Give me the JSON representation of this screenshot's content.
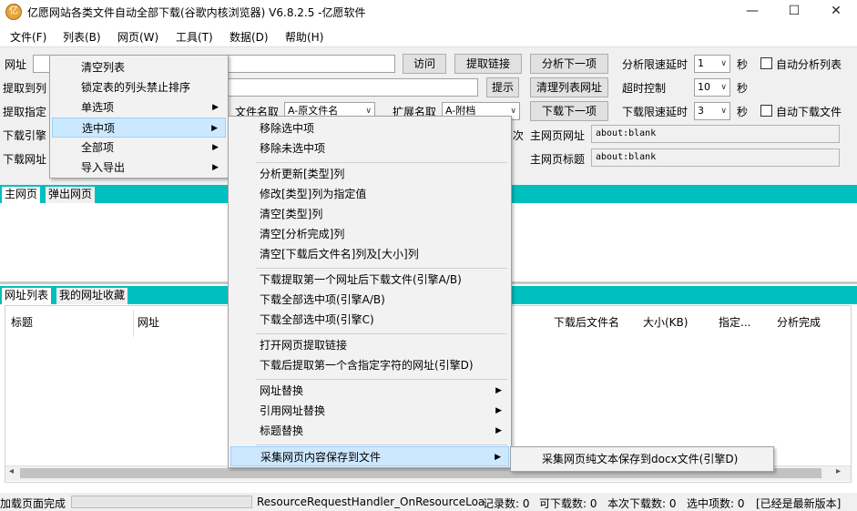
{
  "window": {
    "title": "亿愿网站各类文件自动全部下载(谷歌内核浏览器) V6.8.2.5 -亿愿软件",
    "minimize": "—",
    "maximize": "☐",
    "close": "✕"
  },
  "menubar": [
    "文件(F)",
    "列表(B)",
    "网页(W)",
    "工具(T)",
    "数据(D)",
    "帮助(H)"
  ],
  "form": {
    "url_label": "网址",
    "visit_btn": "访问",
    "extract_btn": "提取链接",
    "analyze_next_btn": "分析下一项",
    "analyze_delay_label": "分析限速延时",
    "analyze_delay_value": "1",
    "sec1": "秒",
    "auto_analyze": "自动分析列表",
    "row2_label": "提取到列",
    "hint_btn": "提示",
    "clear_list_url_btn": "清理列表网址",
    "timeout_label": "超时控制",
    "timeout_value": "10",
    "sec2": "秒",
    "row3_label": "提取指定",
    "filename_label": "文件名取",
    "filename_value": "A-原文件名",
    "ext_label": "扩展名取",
    "ext_value": "A-附档",
    "download_next_btn": "下载下一项",
    "download_delay_label": "下载限速延时",
    "download_delay_value": "3",
    "sec3": "秒",
    "auto_download": "自动下载文件",
    "row4_label": "下载引擎",
    "row4_partial": "次",
    "main_url_label": "主网页网址",
    "main_url_value": "about:blank",
    "row5_label": "下载网址",
    "main_title_label": "主网页标题",
    "main_title_value": "about:blank"
  },
  "browser_tabs": [
    "主网页",
    "弹出网页"
  ],
  "list_tabs": [
    "网址列表",
    "我的网址收藏"
  ],
  "columns": [
    "标题",
    "网址",
    "下载后文件名",
    "大小(KB)",
    "指定...",
    "分析完成"
  ],
  "status": {
    "left": "加载页面完成",
    "handler": "ResourceRequestHandler_OnResourceLoa",
    "records": "记录数: 0",
    "downloadable": "可下载数: 0",
    "this_download": "本次下载数: 0",
    "selected": "选中项数: 0",
    "version": "[已经是最新版本]"
  },
  "menu_list": {
    "items": [
      "清空列表",
      "锁定表的列头禁止排序",
      "单选项",
      "选中项",
      "全部项",
      "导入导出"
    ]
  },
  "menu_selected": {
    "items": [
      "移除选中项",
      "移除未选中项",
      "分析更新[类型]列",
      "修改[类型]列为指定值",
      "清空[类型]列",
      "清空[分析完成]列",
      "清空[下载后文件名]列及[大小]列",
      "下载提取第一个网址后下载文件(引擎A/B)",
      "下载全部选中项(引擎A/B)",
      "下载全部选中项(引擎C)",
      "打开网页提取链接",
      "下载后提取第一个含指定字符的网址(引擎D)",
      "网址替换",
      "引用网址替换",
      "标题替换",
      "采集网页内容保存到文件"
    ]
  },
  "menu_save": {
    "items": [
      "采集网页纯文本保存到docx文件(引擎D)"
    ]
  },
  "colors": {
    "accent": "#00bfbf",
    "highlight": "#cce8ff"
  }
}
